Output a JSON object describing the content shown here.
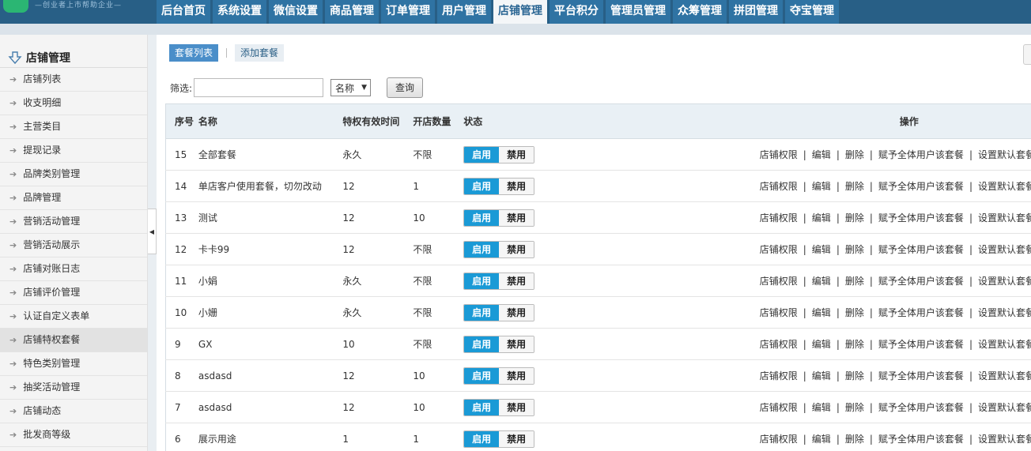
{
  "logo": {
    "slogan": "—创业者上市帮助企业—"
  },
  "nav": [
    "后台首页",
    "系统设置",
    "微信设置",
    "商品管理",
    "订单管理",
    "用户管理",
    "店铺管理",
    "平台积分",
    "管理员管理",
    "众筹管理",
    "拼团管理",
    "夺宝管理"
  ],
  "nav_active": "店铺管理",
  "sidebar": {
    "title": "店铺管理",
    "items": [
      "店铺列表",
      "收支明细",
      "主营类目",
      "提现记录",
      "品牌类别管理",
      "品牌管理",
      "营销活动管理",
      "营销活动展示",
      "店铺对账日志",
      "店铺评价管理",
      "认证自定义表单",
      "店铺特权套餐",
      "特色类别管理",
      "抽奖活动管理",
      "店铺动态",
      "批发商等级"
    ],
    "active": "店铺特权套餐"
  },
  "tabs": {
    "list": "套餐列表",
    "add": "添加套餐"
  },
  "filter": {
    "label": "筛选:",
    "input_value": "",
    "select_value": "名称",
    "button": "查询"
  },
  "table": {
    "headers": {
      "id": "序号",
      "name": "名称",
      "duration": "特权有效时间",
      "count": "开店数量",
      "state": "状态",
      "ops": "操作"
    },
    "toggle": {
      "on": "启用",
      "off": "禁用"
    },
    "ops": [
      "店铺权限",
      "编辑",
      "删除",
      "赋予全体用户该套餐",
      "设置默认套餐"
    ],
    "op_sep": "|",
    "rows": [
      {
        "id": "15",
        "name": "全部套餐",
        "duration": "永久",
        "count": "不限"
      },
      {
        "id": "14",
        "name": "单店客户使用套餐，切勿改动",
        "duration": "12",
        "count": "1"
      },
      {
        "id": "13",
        "name": "测试",
        "duration": "12",
        "count": "10"
      },
      {
        "id": "12",
        "name": "卡卡99",
        "duration": "12",
        "count": "不限"
      },
      {
        "id": "11",
        "name": "小娟",
        "duration": "永久",
        "count": "不限"
      },
      {
        "id": "10",
        "name": "小姗",
        "duration": "永久",
        "count": "不限"
      },
      {
        "id": "9",
        "name": "GX",
        "duration": "10",
        "count": "不限"
      },
      {
        "id": "8",
        "name": "asdasd",
        "duration": "12",
        "count": "10"
      },
      {
        "id": "7",
        "name": "asdasd",
        "duration": "12",
        "count": "10"
      },
      {
        "id": "6",
        "name": "展示用途",
        "duration": "1",
        "count": "1"
      }
    ]
  },
  "colors": {
    "topbar": "#285f86",
    "nav_item": "#2f73a3",
    "toggle_on": "#1a9ad6",
    "tab_active": "#4a8ec9"
  }
}
